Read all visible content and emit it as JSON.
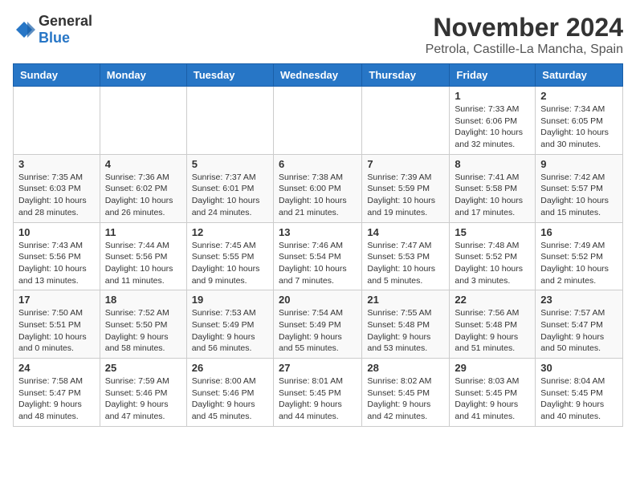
{
  "logo": {
    "general": "General",
    "blue": "Blue"
  },
  "header": {
    "month": "November 2024",
    "location": "Petrola, Castille-La Mancha, Spain"
  },
  "weekdays": [
    "Sunday",
    "Monday",
    "Tuesday",
    "Wednesday",
    "Thursday",
    "Friday",
    "Saturday"
  ],
  "weeks": [
    [
      {
        "day": "",
        "info": ""
      },
      {
        "day": "",
        "info": ""
      },
      {
        "day": "",
        "info": ""
      },
      {
        "day": "",
        "info": ""
      },
      {
        "day": "",
        "info": ""
      },
      {
        "day": "1",
        "info": "Sunrise: 7:33 AM\nSunset: 6:06 PM\nDaylight: 10 hours and 32 minutes."
      },
      {
        "day": "2",
        "info": "Sunrise: 7:34 AM\nSunset: 6:05 PM\nDaylight: 10 hours and 30 minutes."
      }
    ],
    [
      {
        "day": "3",
        "info": "Sunrise: 7:35 AM\nSunset: 6:03 PM\nDaylight: 10 hours and 28 minutes."
      },
      {
        "day": "4",
        "info": "Sunrise: 7:36 AM\nSunset: 6:02 PM\nDaylight: 10 hours and 26 minutes."
      },
      {
        "day": "5",
        "info": "Sunrise: 7:37 AM\nSunset: 6:01 PM\nDaylight: 10 hours and 24 minutes."
      },
      {
        "day": "6",
        "info": "Sunrise: 7:38 AM\nSunset: 6:00 PM\nDaylight: 10 hours and 21 minutes."
      },
      {
        "day": "7",
        "info": "Sunrise: 7:39 AM\nSunset: 5:59 PM\nDaylight: 10 hours and 19 minutes."
      },
      {
        "day": "8",
        "info": "Sunrise: 7:41 AM\nSunset: 5:58 PM\nDaylight: 10 hours and 17 minutes."
      },
      {
        "day": "9",
        "info": "Sunrise: 7:42 AM\nSunset: 5:57 PM\nDaylight: 10 hours and 15 minutes."
      }
    ],
    [
      {
        "day": "10",
        "info": "Sunrise: 7:43 AM\nSunset: 5:56 PM\nDaylight: 10 hours and 13 minutes."
      },
      {
        "day": "11",
        "info": "Sunrise: 7:44 AM\nSunset: 5:56 PM\nDaylight: 10 hours and 11 minutes."
      },
      {
        "day": "12",
        "info": "Sunrise: 7:45 AM\nSunset: 5:55 PM\nDaylight: 10 hours and 9 minutes."
      },
      {
        "day": "13",
        "info": "Sunrise: 7:46 AM\nSunset: 5:54 PM\nDaylight: 10 hours and 7 minutes."
      },
      {
        "day": "14",
        "info": "Sunrise: 7:47 AM\nSunset: 5:53 PM\nDaylight: 10 hours and 5 minutes."
      },
      {
        "day": "15",
        "info": "Sunrise: 7:48 AM\nSunset: 5:52 PM\nDaylight: 10 hours and 3 minutes."
      },
      {
        "day": "16",
        "info": "Sunrise: 7:49 AM\nSunset: 5:52 PM\nDaylight: 10 hours and 2 minutes."
      }
    ],
    [
      {
        "day": "17",
        "info": "Sunrise: 7:50 AM\nSunset: 5:51 PM\nDaylight: 10 hours and 0 minutes."
      },
      {
        "day": "18",
        "info": "Sunrise: 7:52 AM\nSunset: 5:50 PM\nDaylight: 9 hours and 58 minutes."
      },
      {
        "day": "19",
        "info": "Sunrise: 7:53 AM\nSunset: 5:49 PM\nDaylight: 9 hours and 56 minutes."
      },
      {
        "day": "20",
        "info": "Sunrise: 7:54 AM\nSunset: 5:49 PM\nDaylight: 9 hours and 55 minutes."
      },
      {
        "day": "21",
        "info": "Sunrise: 7:55 AM\nSunset: 5:48 PM\nDaylight: 9 hours and 53 minutes."
      },
      {
        "day": "22",
        "info": "Sunrise: 7:56 AM\nSunset: 5:48 PM\nDaylight: 9 hours and 51 minutes."
      },
      {
        "day": "23",
        "info": "Sunrise: 7:57 AM\nSunset: 5:47 PM\nDaylight: 9 hours and 50 minutes."
      }
    ],
    [
      {
        "day": "24",
        "info": "Sunrise: 7:58 AM\nSunset: 5:47 PM\nDaylight: 9 hours and 48 minutes."
      },
      {
        "day": "25",
        "info": "Sunrise: 7:59 AM\nSunset: 5:46 PM\nDaylight: 9 hours and 47 minutes."
      },
      {
        "day": "26",
        "info": "Sunrise: 8:00 AM\nSunset: 5:46 PM\nDaylight: 9 hours and 45 minutes."
      },
      {
        "day": "27",
        "info": "Sunrise: 8:01 AM\nSunset: 5:45 PM\nDaylight: 9 hours and 44 minutes."
      },
      {
        "day": "28",
        "info": "Sunrise: 8:02 AM\nSunset: 5:45 PM\nDaylight: 9 hours and 42 minutes."
      },
      {
        "day": "29",
        "info": "Sunrise: 8:03 AM\nSunset: 5:45 PM\nDaylight: 9 hours and 41 minutes."
      },
      {
        "day": "30",
        "info": "Sunrise: 8:04 AM\nSunset: 5:45 PM\nDaylight: 9 hours and 40 minutes."
      }
    ]
  ]
}
